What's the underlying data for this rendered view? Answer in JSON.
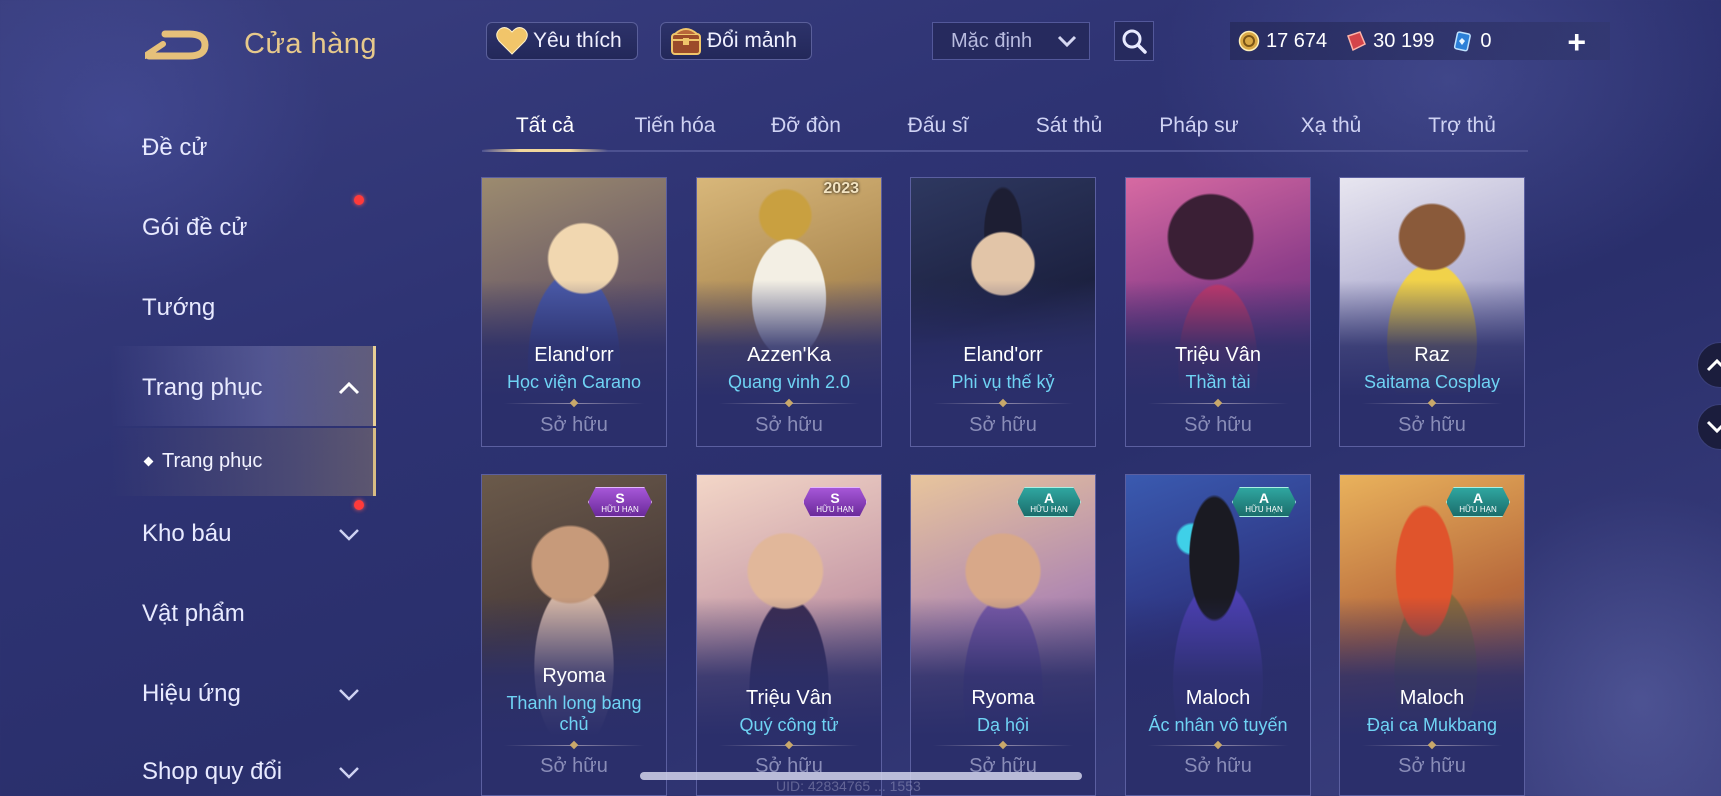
{
  "header": {
    "title": "Cửa hàng",
    "favorites_label": "Yêu thích",
    "exchange_label": "Đổi mảnh",
    "sort_value": "Mặc định",
    "currencies": [
      {
        "icon": "gold-coin-icon",
        "value": "17 674"
      },
      {
        "icon": "voucher-icon",
        "value": "30 199"
      },
      {
        "icon": "diamond-card-icon",
        "value": "0"
      }
    ],
    "plus_label": "+"
  },
  "sidebar": {
    "items": [
      {
        "label": "Đề cử"
      },
      {
        "label": "Gói đề cử"
      },
      {
        "label": "Tướng"
      },
      {
        "label": "Trang phục"
      },
      {
        "label": "Kho báu"
      },
      {
        "label": "Vật phẩm"
      },
      {
        "label": "Hiệu ứng"
      },
      {
        "label": "Shop quy đổi"
      }
    ],
    "sub_item": "Trang phục"
  },
  "tabs": [
    "Tất cả",
    "Tiến hóa",
    "Đỡ đòn",
    "Đấu sĩ",
    "Sát thủ",
    "Pháp sư",
    "Xạ thủ",
    "Trợ thủ"
  ],
  "cards": [
    {
      "hero": "Eland'orr",
      "skin": "Học viện Carano",
      "status": "Sở hữu"
    },
    {
      "hero": "Azzen'Ka",
      "skin": "Quang vinh 2.0",
      "status": "Sở hữu",
      "year": "2023"
    },
    {
      "hero": "Eland'orr",
      "skin": "Phi vụ thế kỷ",
      "status": "Sở hữu"
    },
    {
      "hero": "Triệu Vân",
      "skin": "Thần tài",
      "status": "Sở hữu"
    },
    {
      "hero": "Raz",
      "skin": "Saitama Cosplay",
      "status": "Sở hữu"
    },
    {
      "hero": "Ryoma",
      "skin_line1": "Thanh long bang",
      "skin_line2": "chủ",
      "status": "Sở hữu",
      "badge_tier": "S",
      "badge_text": "HỮU HẠN"
    },
    {
      "hero": "Triệu Vân",
      "skin": "Quý công tử",
      "status": "Sở hữu",
      "badge_tier": "S",
      "badge_text": "HỮU HẠN"
    },
    {
      "hero": "Ryoma",
      "skin": "Dạ hội",
      "status": "Sở hữu",
      "badge_tier": "A",
      "badge_text": "HỮU HẠN"
    },
    {
      "hero": "Maloch",
      "skin": "Ác nhân vô tuyến",
      "status": "Sở hữu",
      "badge_tier": "A",
      "badge_text": "HỮU HẠN"
    },
    {
      "hero": "Maloch",
      "skin": "Đại ca Mukbang",
      "status": "Sở hữu",
      "badge_tier": "A",
      "badge_text": "HỮU HẠN"
    }
  ],
  "footer": {
    "uid": "UID: 42834765 ... 1553"
  },
  "colors": {
    "accent_gold": "#e7c98b",
    "skin_name": "#6fd3f4",
    "notification": "#ff3a3a"
  }
}
